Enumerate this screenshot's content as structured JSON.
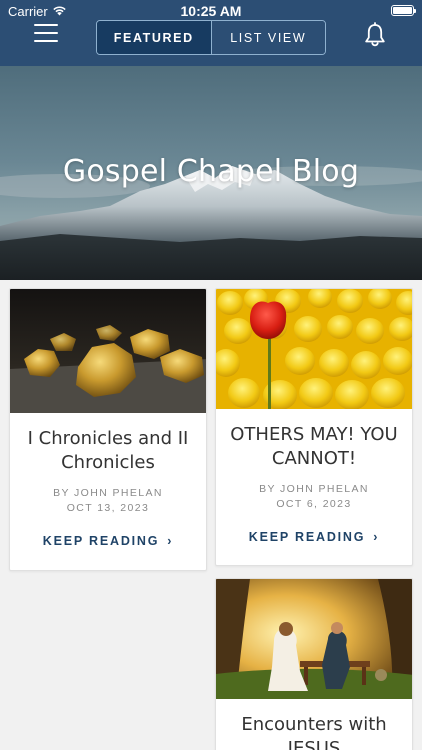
{
  "status_bar": {
    "carrier": "Carrier",
    "time": "10:25 AM"
  },
  "nav": {
    "tabs": [
      {
        "label": "FEATURED",
        "active": true
      },
      {
        "label": "LIST VIEW",
        "active": false
      }
    ],
    "menu_icon": "hamburger-menu-icon",
    "bell_icon": "bell-icon"
  },
  "hero": {
    "title": "Gospel Chapel Blog"
  },
  "posts": [
    {
      "title": "I Chronicles and II Chronicles",
      "author": "BY JOHN  PHELAN",
      "date": "OCT 13, 2023",
      "cta": "KEEP READING",
      "image": "gold-nuggets"
    },
    {
      "title": "OTHERS MAY! YOU CANNOT!",
      "author": "BY JOHN  PHELAN",
      "date": "OCT 6, 2023",
      "cta": "KEEP READING",
      "image": "red-tulip-among-yellow"
    },
    {
      "title": "Encounters with JESUS",
      "image": "jesus-talking-on-bench"
    }
  ],
  "colors": {
    "nav_bg": "#2c4e74",
    "tab_active_bg": "#173b61",
    "cta": "#1f4367"
  }
}
